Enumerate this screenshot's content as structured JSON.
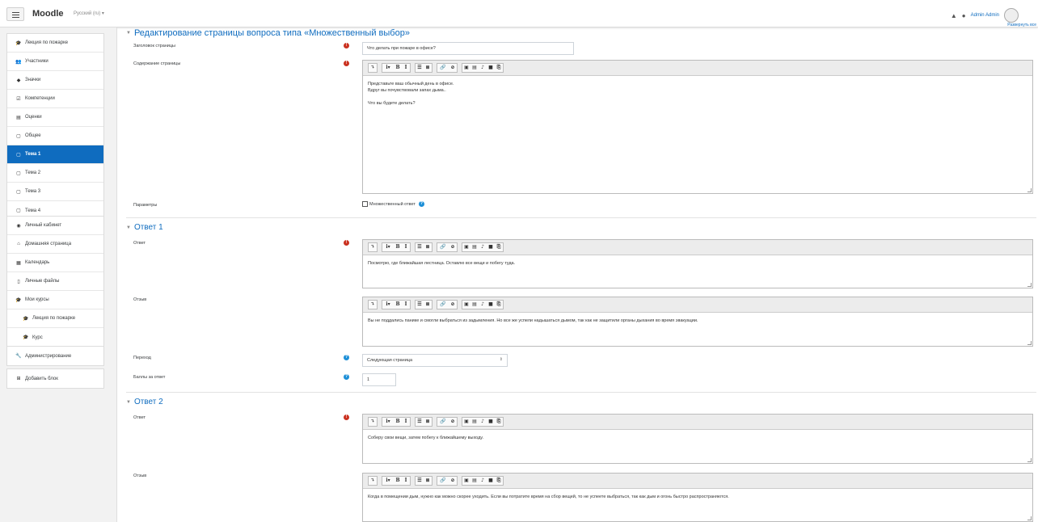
{
  "header": {
    "brand": "Moodle",
    "language": "Русский (ru) ▾",
    "user_name": "Admin Admin",
    "top_right_link": "Развернуть все"
  },
  "sidebar": {
    "group1": [
      {
        "icon": "🎓",
        "label": "Лекция по пожарке"
      },
      {
        "icon": "👥",
        "label": "Участники"
      },
      {
        "icon": "◆",
        "label": "Значки"
      },
      {
        "icon": "☑",
        "label": "Компетенции"
      },
      {
        "icon": "▤",
        "label": "Оценки"
      },
      {
        "icon": "▢",
        "label": "Общее"
      },
      {
        "icon": "▢",
        "label": "Тема 1"
      },
      {
        "icon": "▢",
        "label": "Тема 2"
      },
      {
        "icon": "▢",
        "label": "Тема 3"
      },
      {
        "icon": "▢",
        "label": "Тема 4"
      }
    ],
    "group2": [
      {
        "icon": "◉",
        "label": "Личный кабинет"
      },
      {
        "icon": "⌂",
        "label": "Домашняя страница"
      },
      {
        "icon": "▦",
        "label": "Календарь"
      },
      {
        "icon": "▯",
        "label": "Личные файлы"
      },
      {
        "icon": "🎓",
        "label": "Мои курсы"
      },
      {
        "icon": "🎓",
        "label": "Лекция по пожарке"
      },
      {
        "icon": "🎓",
        "label": "Курс"
      }
    ],
    "admin": {
      "icon": "🔧",
      "label": "Администрирование"
    },
    "addblock": {
      "icon": "⊞",
      "label": "Добавить блок"
    }
  },
  "form": {
    "title": "Редактирование страницы вопроса типа «Множественный выбор»",
    "page_title_label": "Заголовок страницы",
    "page_title_value": "Что делать при пожаре в офисе?",
    "content_label": "Содержание страницы",
    "content_text": "Представьте ваш обычный день в офисе.\nВдруг вы почувствовали запах дыма..\n\nЧто вы будете делать?",
    "params_label": "Параметры",
    "multi_answer_label": "Множественный ответ",
    "answer1": {
      "heading": "Ответ 1",
      "answer_label": "Ответ",
      "answer_text": "Посмотрю, где ближайшая лестница. Оставлю все вещи и побегу туда.",
      "feedback_label": "Отзыв",
      "feedback_text": "Вы не поддались панике и смогли выбраться из задымления. Но все же успели надышаться дымом, так как не защитили органы дыхания во время эвакуации.",
      "jump_label": "Переход",
      "jump_value": "Следующая страница",
      "score_label": "Баллы за ответ",
      "score_value": "1"
    },
    "answer2": {
      "heading": "Ответ 2",
      "answer_label": "Ответ",
      "answer_text": "Соберу свои вещи, затем побегу к ближайшему выходу.",
      "feedback_label": "Отзыв",
      "feedback_text": "Когда в помещении дым, нужно как можно скорее уходить. Если вы потратите время на сбор вещей, то не успеете выбраться, так как дым и огонь быстро распространяются."
    }
  },
  "colors": {
    "accent": "#0f6cbf",
    "required": "#ca3120",
    "help": "#1d8fd7"
  }
}
